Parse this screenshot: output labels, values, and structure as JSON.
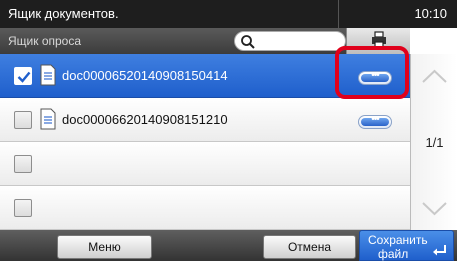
{
  "header": {
    "title": "Ящик документов.",
    "time": "10:10"
  },
  "toolbar": {
    "subtitle": "Ящик опроса",
    "search_icon": "search-icon",
    "sort_icon": "printer-icon"
  },
  "files": [
    {
      "name": "doc00006520140908150414",
      "checked": true,
      "selected": true
    },
    {
      "name": "doc00006620140908151210",
      "checked": false,
      "selected": false
    },
    {
      "name": "",
      "checked": false,
      "selected": false
    },
    {
      "name": "",
      "checked": false,
      "selected": false
    }
  ],
  "pager": {
    "page": "1/1"
  },
  "footer": {
    "menu_label": "Меню",
    "cancel_label": "Отмена",
    "save_label_line1": "Сохранить",
    "save_label_line2": "файл"
  },
  "colors": {
    "selection": "#1f5fcc",
    "highlight": "#e0001b",
    "titlebar": "#1e1e1e"
  }
}
